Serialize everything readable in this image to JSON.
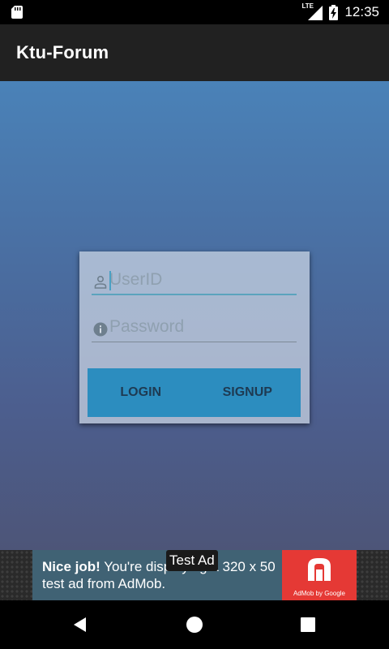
{
  "status_bar": {
    "time": "12:35",
    "network_label": "LTE",
    "icons": [
      "sd-card-icon",
      "lte-signal-icon",
      "battery-charging-icon"
    ]
  },
  "app_bar": {
    "title": "Ktu-Forum"
  },
  "login_form": {
    "userid_placeholder": "UserID",
    "password_placeholder": "Password",
    "userid_icon": "person-icon",
    "password_icon": "info-icon",
    "login_label": "LOGIN",
    "signup_label": "SIGNUP",
    "accent_color": "#2c8dbf"
  },
  "ad_banner": {
    "headline": "Nice job!",
    "body": "You're displaying a 320 x 50 test ad from AdMob.",
    "badge": "Test Ad",
    "logo_caption": "AdMob by Google",
    "logo_color": "#e53935"
  },
  "nav_bar": {
    "icons": [
      "back-icon",
      "home-icon",
      "recents-icon"
    ]
  }
}
